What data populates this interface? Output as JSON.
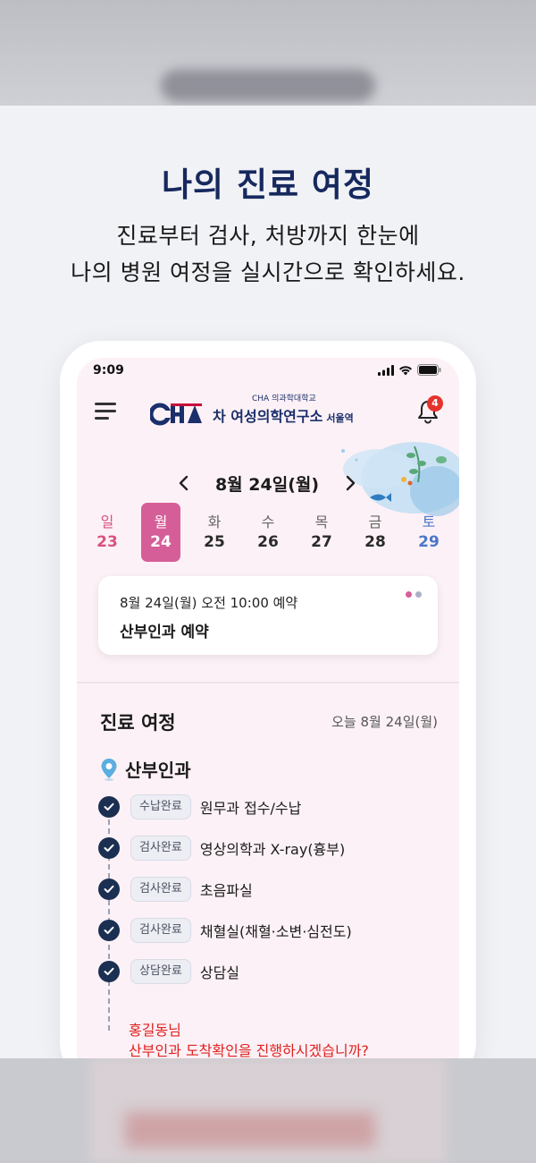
{
  "promo": {
    "title": "나의 진료 여정",
    "subtitle_line1": "진료부터 검사, 처방까지 한눈에",
    "subtitle_line2": "나의 병원 여정을 실시간으로 확인하세요."
  },
  "status_bar": {
    "time": "9:09",
    "icons": [
      "signal-icon",
      "wifi-icon",
      "battery-icon"
    ]
  },
  "app_bar": {
    "menu_icon": "hamburger-menu-icon",
    "logo": {
      "mark_text": "CHA",
      "small_text": "CHA 의과학대학교",
      "name": "차 여성의학연구소",
      "branch": "서울역"
    },
    "notification_icon": "bell-icon",
    "notification_count": "4"
  },
  "calendar": {
    "month_label": "8월 24일(월)",
    "prev_icon": "chevron-left-icon",
    "next_icon": "chevron-right-icon",
    "days": [
      {
        "dow": "일",
        "num": "23",
        "type": "sun",
        "selected": false
      },
      {
        "dow": "월",
        "num": "24",
        "type": "norm",
        "selected": true
      },
      {
        "dow": "화",
        "num": "25",
        "type": "norm",
        "selected": false
      },
      {
        "dow": "수",
        "num": "26",
        "type": "norm",
        "selected": false
      },
      {
        "dow": "목",
        "num": "27",
        "type": "norm",
        "selected": false
      },
      {
        "dow": "금",
        "num": "28",
        "type": "norm",
        "selected": false
      },
      {
        "dow": "토",
        "num": "29",
        "type": "sat",
        "selected": false
      }
    ]
  },
  "appointment": {
    "datetime": "8월 24일(월) 오전 10:00 예약",
    "title": "산부인과 예약",
    "page_dots": 2
  },
  "journey": {
    "title": "진료 여정",
    "date": "오늘 8월 24일(월)",
    "department": "산부인과",
    "department_icon": "location-pin-icon",
    "steps": [
      {
        "badge": "수납완료",
        "label": "원무과 접수/수납"
      },
      {
        "badge": "검사완료",
        "label": "영상의학과 X-ray(흉부)"
      },
      {
        "badge": "검사완료",
        "label": "초음파실"
      },
      {
        "badge": "검사완료",
        "label": "채혈실(채혈·소변·심전도)"
      },
      {
        "badge": "상담완료",
        "label": "상담실"
      }
    ],
    "prompt_line1": "홍길동님",
    "prompt_line2": "산부인과 도착확인을 진행하시겠습니까?"
  },
  "colors": {
    "navy": "#16295e",
    "pink_selected": "#d65e98",
    "sunday": "#d8527f",
    "saturday": "#4b77c7",
    "alert_red": "#e0211f",
    "check_navy": "#1b2f52"
  }
}
